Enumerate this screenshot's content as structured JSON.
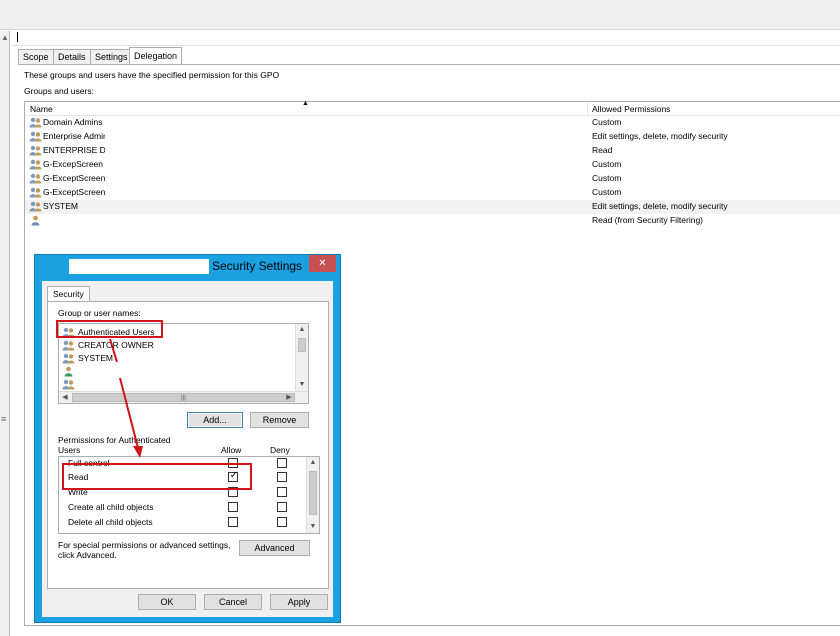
{
  "tabs": [
    {
      "label": "Scope"
    },
    {
      "label": "Details"
    },
    {
      "label": "Settings"
    },
    {
      "label": "Delegation"
    }
  ],
  "delegation": {
    "description": "These groups and users have the specified permission for this GPO",
    "groups_label": "Groups and users:",
    "columns": {
      "name": "Name",
      "permissions": "Allowed Permissions"
    },
    "rows": [
      {
        "name": "Domain Admins",
        "permission": "Custom"
      },
      {
        "name": "Enterprise Admins",
        "permission": "Edit settings, delete, modify security"
      },
      {
        "name": "ENTERPRISE DOMAIN CONTROLLERS",
        "permission": "Read"
      },
      {
        "name": "G-ExcepScreen",
        "permission": "Custom"
      },
      {
        "name": "G-ExceptScreen",
        "permission": "Custom"
      },
      {
        "name": "G-ExceptScreen",
        "permission": "Custom"
      },
      {
        "name": "SYSTEM",
        "permission": "Edit settings, delete, modify security"
      },
      {
        "name": "",
        "permission": "Read (from Security Filtering)"
      }
    ]
  },
  "dialog": {
    "title": "Security Settings",
    "close_glyph": "✕",
    "tab": "Security",
    "group_names_label": "Group or user names:",
    "users": [
      {
        "name": "Authenticated Users"
      },
      {
        "name": "CREATOR OWNER"
      },
      {
        "name": "SYSTEM"
      },
      {
        "name": ""
      },
      {
        "name": ""
      }
    ],
    "add_button": "Add...",
    "remove_button": "Remove",
    "permissions_for_line1": "Permissions for Authenticated",
    "permissions_for_line2": "Users",
    "allow_col": "Allow",
    "deny_col": "Deny",
    "permissions": [
      {
        "name": "Full control",
        "allow": false,
        "deny": false
      },
      {
        "name": "Read",
        "allow": true,
        "deny": false
      },
      {
        "name": "Write",
        "allow": false,
        "deny": false
      },
      {
        "name": "Create all child objects",
        "allow": false,
        "deny": false
      },
      {
        "name": "Delete all child objects",
        "allow": false,
        "deny": false
      }
    ],
    "special_line1": "For special permissions or advanced settings,",
    "special_line2": "click Advanced.",
    "advanced_button": "Advanced",
    "ok_button": "OK",
    "cancel_button": "Cancel",
    "apply_button": "Apply"
  },
  "colors": {
    "dialog_frame": "#1ba1e2",
    "close_button": "#c75050",
    "highlight": "#d0141b"
  }
}
